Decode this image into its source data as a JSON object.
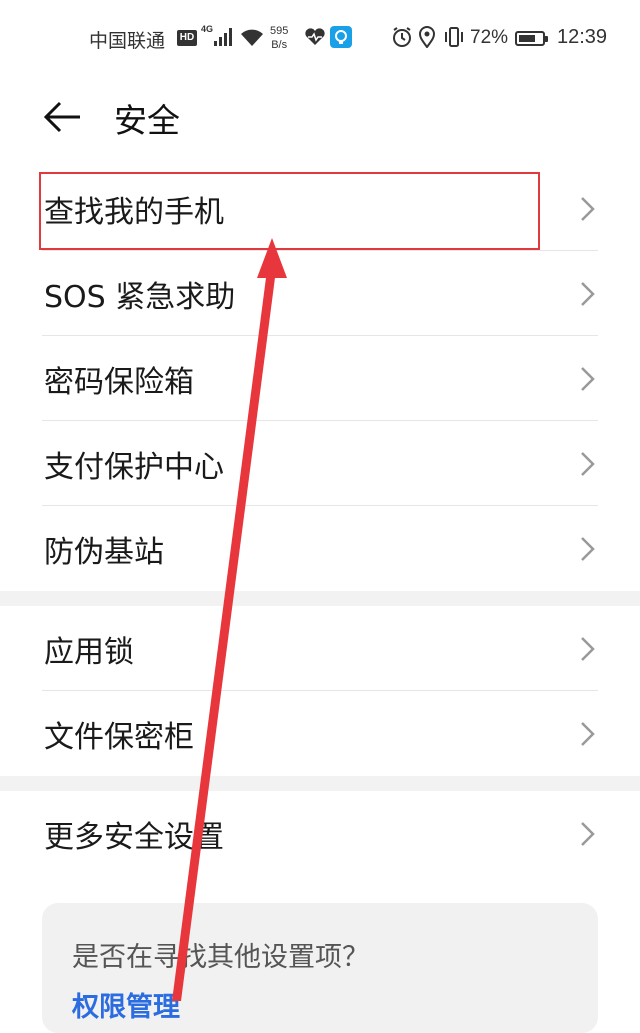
{
  "status_bar": {
    "carrier": "中国联通",
    "hd": "HD",
    "network": "4G",
    "speed_value": "595",
    "speed_unit": "B/s",
    "battery_percent": "72%",
    "battery_level": 0.72,
    "time": "12:39",
    "icons": [
      "signal-icon",
      "wifi-icon",
      "heart-icon",
      "app-notification-icon",
      "alarm-icon",
      "location-icon",
      "vibrate-icon",
      "battery-icon"
    ]
  },
  "header": {
    "back_icon": "back-arrow-icon",
    "title": "安全"
  },
  "groups": [
    {
      "items": [
        {
          "label": "查找我的手机",
          "icon": "chevron-right-icon"
        },
        {
          "label": "SOS 紧急求助",
          "icon": "chevron-right-icon"
        },
        {
          "label": "密码保险箱",
          "icon": "chevron-right-icon"
        },
        {
          "label": "支付保护中心",
          "icon": "chevron-right-icon"
        },
        {
          "label": "防伪基站",
          "icon": "chevron-right-icon"
        }
      ]
    },
    {
      "items": [
        {
          "label": "应用锁",
          "icon": "chevron-right-icon"
        },
        {
          "label": "文件保密柜",
          "icon": "chevron-right-icon"
        }
      ]
    },
    {
      "items": [
        {
          "label": "更多安全设置",
          "icon": "chevron-right-icon"
        }
      ]
    }
  ],
  "suggestion": {
    "question": "是否在寻找其他设置项？",
    "link": "权限管理"
  },
  "annotation": {
    "highlight_color": "#e0393e",
    "arrow_color": "#e8373c"
  }
}
